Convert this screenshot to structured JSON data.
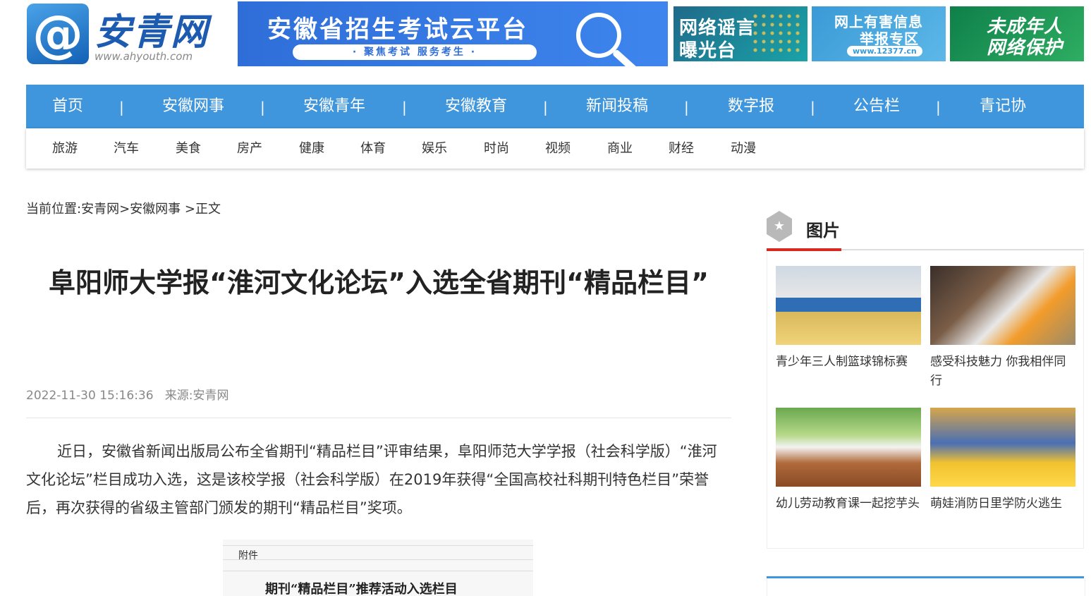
{
  "header": {
    "logo": {
      "symbol": "@",
      "name": "安青网",
      "url": "www.ahyouth.com"
    },
    "banner_main": {
      "title": "安徽省招生考试云平台",
      "subtitle": "· 聚焦考试  服务考生 ·"
    },
    "ads": [
      {
        "line1": "网络谣言",
        "line2": "曝光台"
      },
      {
        "line1": "网上有害信息",
        "line2": "举报专区",
        "line3": "www.12377.cn"
      },
      {
        "line1": "未成年人",
        "line2": "网络保护"
      }
    ]
  },
  "nav": {
    "items": [
      "首页",
      "安徽网事",
      "安徽青年",
      "安徽教育",
      "新闻投稿",
      "数字报",
      "公告栏",
      "青记协"
    ],
    "separator": "|",
    "sub_items": [
      "旅游",
      "汽车",
      "美食",
      "房产",
      "健康",
      "体育",
      "娱乐",
      "时尚",
      "视频",
      "商业",
      "财经",
      "动漫"
    ]
  },
  "breadcrumb": {
    "label": "当前位置:",
    "path1": "安青网",
    "sep1": ">",
    "path2": "安徽网事",
    "sep2": " >",
    "current": "正文"
  },
  "article": {
    "title": "阜阳师大学报“淮河文化论坛”入选全省期刊“精品栏目”",
    "date": "2022-11-30 15:16:36",
    "source_label": "来源:",
    "source": "安青网",
    "paragraph": "近日，安徽省新闻出版局公布全省期刊“精品栏目”评审结果，阜阳师范大学学报（社会科学版）“淮河文化论坛”栏目成功入选，这是该校学报（社会科学版）在2019年获得“全国高校社科期刊特色栏目”荣誉后，再次获得的省级主管部门颁发的期刊“精品栏目”奖项。",
    "scan": {
      "attachment": "附件",
      "heading": "期刊“精品栏目”推荐活动入选栏目"
    }
  },
  "sidebar": {
    "title": "图片",
    "icon": "star-icon",
    "accent": "#d9281f",
    "items": [
      {
        "caption": "青少年三人制篮球锦标赛"
      },
      {
        "caption": "感受科技魅力 你我相伴同行"
      },
      {
        "caption": "幼儿劳动教育课一起挖芋头"
      },
      {
        "caption": "萌娃消防日里学防火逃生"
      }
    ]
  },
  "colors": {
    "nav": "#3f96dc",
    "text": "#333333"
  }
}
